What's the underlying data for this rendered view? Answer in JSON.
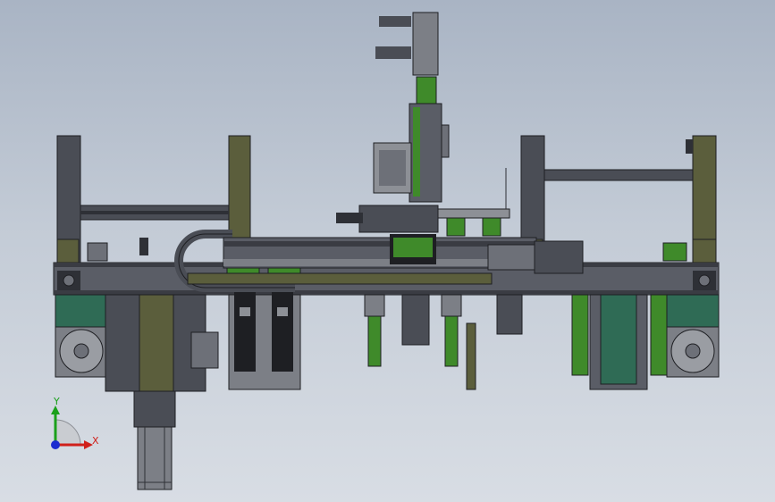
{
  "view": {
    "background_top": "#a9b4c4",
    "background_bottom": "#d8dde4",
    "frame_color": "#4a4d55",
    "frame_dark": "#2e3036",
    "olive_color": "#5b5e3c",
    "green_component": "#3f8a2a",
    "teal_motor": "#2f6b55",
    "motor_gray": "#8d9096"
  },
  "axes": {
    "x_label": "X",
    "y_label": "Y",
    "x_color": "#d0201a",
    "y_color": "#1aa01a",
    "z_color": "#1a2ad0"
  }
}
